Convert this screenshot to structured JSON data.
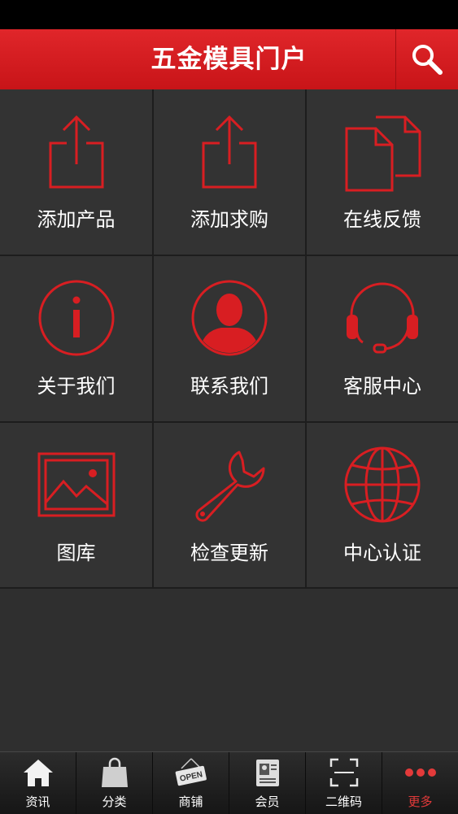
{
  "header": {
    "title": "五金模具门户"
  },
  "grid": [
    {
      "label": "添加产品",
      "icon": "upload-icon"
    },
    {
      "label": "添加求购",
      "icon": "upload-icon"
    },
    {
      "label": "在线反馈",
      "icon": "documents-icon"
    },
    {
      "label": "关于我们",
      "icon": "info-icon"
    },
    {
      "label": "联系我们",
      "icon": "person-icon"
    },
    {
      "label": "客服中心",
      "icon": "headset-icon"
    },
    {
      "label": "图库",
      "icon": "picture-icon"
    },
    {
      "label": "检查更新",
      "icon": "wrench-icon"
    },
    {
      "label": "中心认证",
      "icon": "globe-icon"
    }
  ],
  "tabbar": [
    {
      "label": "资讯",
      "icon": "home-icon",
      "active": false
    },
    {
      "label": "分类",
      "icon": "shopping-bag-icon",
      "active": false
    },
    {
      "label": "商铺",
      "icon": "open-sign-icon",
      "sign_text": "OPEN",
      "active": false
    },
    {
      "label": "会员",
      "icon": "id-card-icon",
      "active": false
    },
    {
      "label": "二维码",
      "icon": "qr-scan-icon",
      "active": false
    },
    {
      "label": "更多",
      "icon": "more-dots-icon",
      "active": true
    }
  ],
  "colors": {
    "accent": "#d81e22",
    "background": "#2f2f2f",
    "active_tab": "#e33a3a"
  }
}
